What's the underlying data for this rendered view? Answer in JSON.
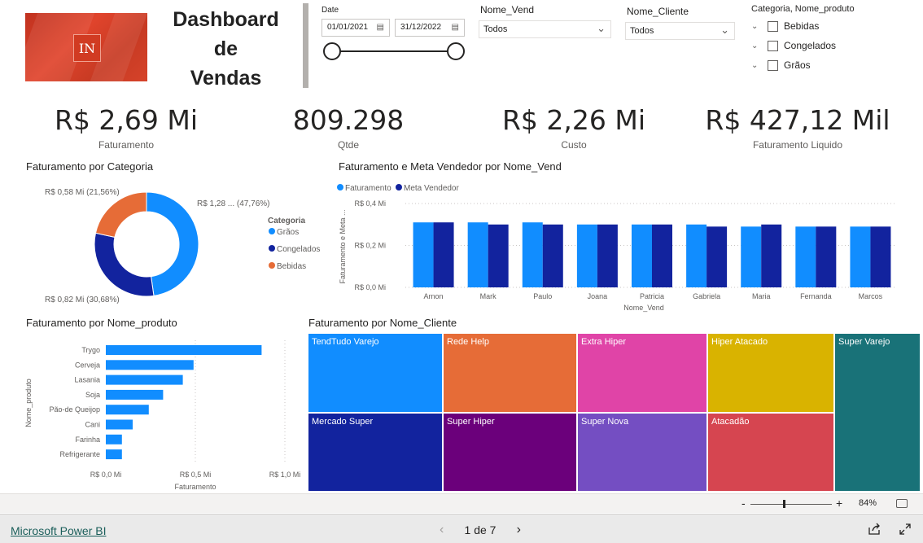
{
  "header": {
    "logo_text": "IN",
    "title_lines": [
      "Dashboard",
      "de",
      "Vendas"
    ]
  },
  "filters": {
    "date": {
      "label": "Date",
      "start": "01/01/2021",
      "end": "31/12/2022"
    },
    "vendedor": {
      "label": "Nome_Vend",
      "value": "Todos"
    },
    "cliente": {
      "label": "Nome_Cliente",
      "value": "Todos"
    },
    "categoria": {
      "label": "Categoria, Nome_produto",
      "items": [
        "Bebidas",
        "Congelados",
        "Grãos"
      ]
    }
  },
  "kpis": [
    {
      "value": "R$ 2,69 Mi",
      "label": "Faturamento"
    },
    {
      "value": "809.298",
      "label": "Qtde"
    },
    {
      "value": "R$ 2,26 Mi",
      "label": "Custo"
    },
    {
      "value": "R$ 427,12 Mil",
      "label": "Faturamento Liquido"
    }
  ],
  "colors": {
    "graos": "#118dff",
    "congelados": "#12239e",
    "bebidas": "#e66c37"
  },
  "chart_data": [
    {
      "type": "pie",
      "variant": "donut",
      "title": "Faturamento por Categoria",
      "legend_title": "Categoria",
      "legend_position": "right",
      "slices": [
        {
          "name": "Grãos",
          "value": 47.76,
          "label": "R$ 1,28 ... (47,76%)",
          "color": "#118dff"
        },
        {
          "name": "Congelados",
          "value": 30.68,
          "label": "R$ 0,82 Mi (30,68%)",
          "color": "#12239e"
        },
        {
          "name": "Bebidas",
          "value": 21.56,
          "label": "R$ 0,58 Mi (21,56%)",
          "color": "#e66c37"
        }
      ]
    },
    {
      "type": "bar",
      "title": "Faturamento e Meta Vendedor por Nome_Vend",
      "xlabel": "Nome_Vend",
      "ylabel": "Faturamento e Meta ...",
      "legend_position": "top-left",
      "categories": [
        "Arnon",
        "Mark",
        "Paulo",
        "Joana",
        "Patricia",
        "Gabriela",
        "Maria",
        "Fernanda",
        "Marcos"
      ],
      "series": [
        {
          "name": "Faturamento",
          "color": "#118dff",
          "values": [
            0.31,
            0.31,
            0.31,
            0.3,
            0.3,
            0.3,
            0.29,
            0.29,
            0.29
          ]
        },
        {
          "name": "Meta Vendedor",
          "color": "#12239e",
          "values": [
            0.31,
            0.3,
            0.3,
            0.3,
            0.3,
            0.29,
            0.3,
            0.29,
            0.29
          ]
        }
      ],
      "ylim": [
        0,
        0.4
      ],
      "yticks": [
        "R$ 0,0 Mi",
        "R$ 0,2 Mi",
        "R$ 0,4 Mi"
      ],
      "grid": true
    },
    {
      "type": "bar",
      "orientation": "horizontal",
      "title": "Faturamento por Nome_produto",
      "xlabel": "Faturamento",
      "ylabel": "Nome_produto",
      "categories": [
        "Trygo",
        "Cerveja",
        "Lasania",
        "Soja",
        "Pão-de Queijop",
        "Cani",
        "Farinha",
        "Refrigerante"
      ],
      "values": [
        0.87,
        0.49,
        0.43,
        0.32,
        0.24,
        0.15,
        0.09,
        0.09
      ],
      "color": "#118dff",
      "xlim": [
        0,
        1.0
      ],
      "xticks": [
        "R$ 0,0 Mi",
        "R$ 0,5 Mi",
        "R$ 1,0 Mi"
      ],
      "grid": true
    },
    {
      "type": "treemap",
      "title": "Faturamento por Nome_Cliente",
      "items": [
        {
          "name": "TendTudo Varejo",
          "color": "#118dff"
        },
        {
          "name": "Mercado Super",
          "color": "#12239e"
        },
        {
          "name": "Rede Help",
          "color": "#e66c37"
        },
        {
          "name": "Super Hiper",
          "color": "#6b007b"
        },
        {
          "name": "Extra Hiper",
          "color": "#e044a7"
        },
        {
          "name": "Super Nova",
          "color": "#744ec2"
        },
        {
          "name": "Hiper Atacado",
          "color": "#d9b300"
        },
        {
          "name": "Atacadão",
          "color": "#d64550"
        },
        {
          "name": "Super Varejo",
          "color": "#197278"
        }
      ]
    }
  ],
  "zoom": {
    "minus": "-",
    "plus": "+",
    "level": "84%"
  },
  "footer": {
    "brand": "Microsoft Power BI",
    "page": "1 de 7"
  }
}
